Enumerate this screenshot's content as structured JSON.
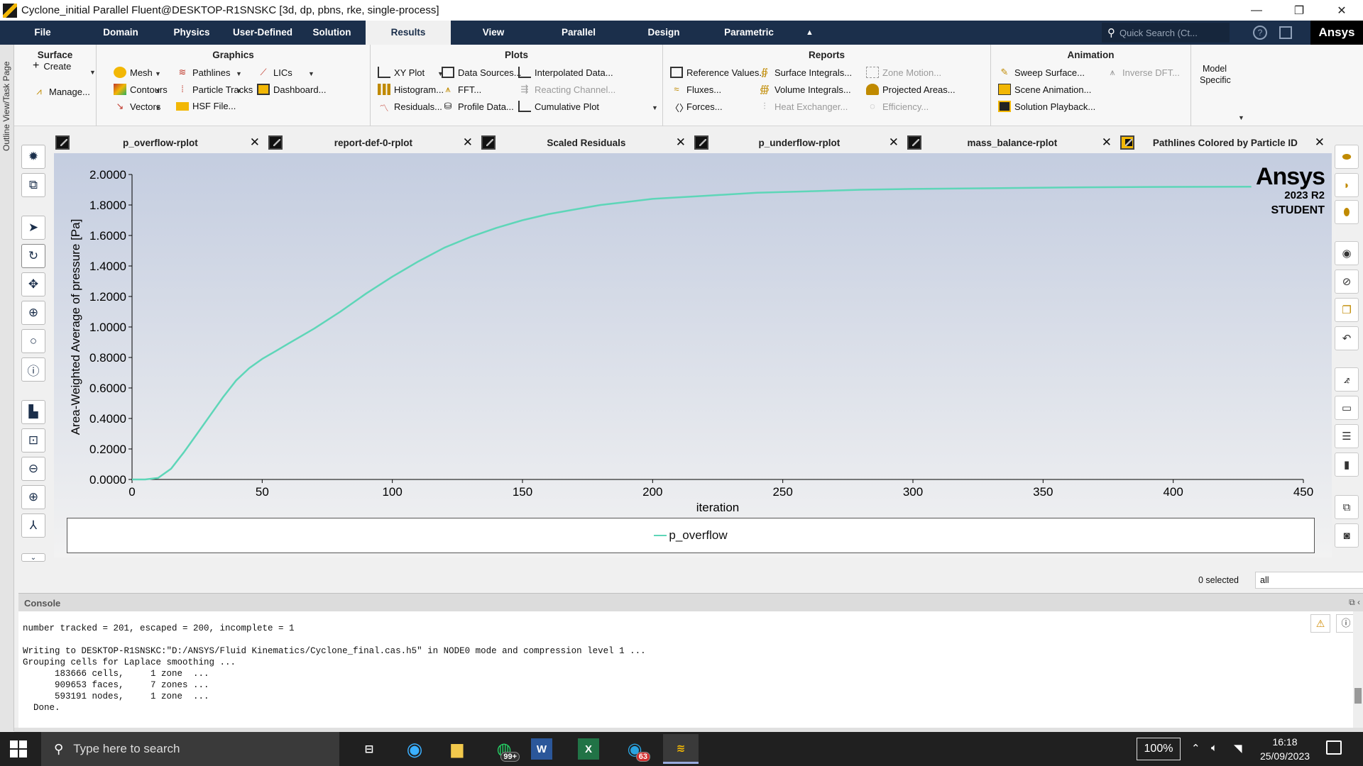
{
  "window": {
    "title": "Cyclone_initial Parallel Fluent@DESKTOP-R1SNSKC  [3d, dp, pbns, rke, single-process]",
    "min_glyph": "—",
    "restore_glyph": "❐",
    "close_glyph": "✕"
  },
  "menu": {
    "tabs": [
      "File",
      "Domain",
      "Physics",
      "User-Defined",
      "Solution",
      "Results",
      "View",
      "Parallel",
      "Design",
      "Parametric"
    ],
    "active": "Results",
    "quick_search_placeholder": "Quick Search (Ct...",
    "brand": "Ansys"
  },
  "ribbon": {
    "surface": {
      "title": "Surface",
      "create": "Create",
      "manage": "Manage..."
    },
    "graphics": {
      "title": "Graphics",
      "mesh": "Mesh",
      "contours": "Contours",
      "vectors": "Vectors",
      "pathlines": "Pathlines",
      "particle_tracks": "Particle Tracks",
      "hsf_file": "HSF File...",
      "lics": "LICs",
      "dashboard": "Dashboard..."
    },
    "plots": {
      "title": "Plots",
      "xy_plot": "XY Plot",
      "histogram": "Histogram...",
      "residuals": "Residuals...",
      "data_sources": "Data Sources...",
      "fft": "FFT...",
      "profile_data": "Profile Data...",
      "interpolated_data": "Interpolated Data...",
      "reacting_channel": "Reacting Channel...",
      "cumulative_plot": "Cumulative Plot"
    },
    "reports": {
      "title": "Reports",
      "reference_values": "Reference Values...",
      "fluxes": "Fluxes...",
      "forces": "Forces...",
      "surface_integrals": "Surface Integrals...",
      "volume_integrals": "Volume Integrals...",
      "heat_exchanger": "Heat Exchanger...",
      "zone_motion": "Zone Motion...",
      "projected_areas": "Projected Areas...",
      "efficiency": "Efficiency..."
    },
    "animation": {
      "title": "Animation",
      "sweep_surface": "Sweep Surface...",
      "scene_animation": "Scene Animation...",
      "solution_playback": "Solution Playback...",
      "inverse_dft": "Inverse DFT..."
    },
    "model_specific": {
      "line1": "Model",
      "line2": "Specific"
    }
  },
  "sidebar": {
    "outline_label": "Outline View/Task Page"
  },
  "doc_tabs": [
    "p_overflow-rplot",
    "report-def-0-rplot",
    "Scaled Residuals",
    "p_underflow-rplot",
    "mass_balance-rplot",
    "Pathlines Colored by Particle ID"
  ],
  "active_doc_tab": "p_overflow-rplot",
  "watermark": {
    "brand": "Ansys",
    "version": "2023 R2",
    "edition": "STUDENT"
  },
  "chart_data": {
    "type": "line",
    "xlabel": "iteration",
    "ylabel": "Area-Weighted Average of pressure [Pa]",
    "xlim": [
      0,
      450
    ],
    "ylim": [
      0,
      2.0
    ],
    "x_ticks": [
      "0",
      "50",
      "100",
      "150",
      "200",
      "250",
      "300",
      "350",
      "400",
      "450"
    ],
    "y_ticks": [
      "0.0000",
      "0.2000",
      "0.4000",
      "0.6000",
      "0.8000",
      "1.0000",
      "1.2000",
      "1.4000",
      "1.6000",
      "1.8000",
      "2.0000"
    ],
    "grid": false,
    "legend_position": "bottom",
    "series": [
      {
        "name": "p_overflow",
        "color": "#5ed6b8",
        "x": [
          0,
          5,
          10,
          15,
          20,
          25,
          30,
          35,
          40,
          45,
          50,
          55,
          60,
          65,
          70,
          80,
          90,
          100,
          110,
          120,
          130,
          140,
          150,
          160,
          170,
          180,
          190,
          200,
          220,
          240,
          260,
          280,
          300,
          330,
          360,
          390,
          430
        ],
        "y": [
          0.0,
          0.0,
          0.01,
          0.07,
          0.18,
          0.3,
          0.42,
          0.54,
          0.65,
          0.73,
          0.79,
          0.84,
          0.89,
          0.94,
          0.99,
          1.1,
          1.22,
          1.33,
          1.43,
          1.52,
          1.59,
          1.65,
          1.7,
          1.74,
          1.77,
          1.8,
          1.82,
          1.84,
          1.86,
          1.88,
          1.89,
          1.9,
          1.905,
          1.91,
          1.915,
          1.918,
          1.92
        ]
      }
    ]
  },
  "selection": {
    "count_label": "0 selected",
    "filter_value": "all"
  },
  "console": {
    "title": "Console",
    "text": "number tracked = 201, escaped = 200, incomplete = 1\n\nWriting to DESKTOP-R1SNSKC:\"D:/ANSYS/Fluid Kinematics/Cyclone_final.cas.h5\" in NODE0 mode and compression level 1 ...\nGrouping cells for Laplace smoothing ...\n      183666 cells,     1 zone  ...\n      909653 faces,     7 zones ...\n      593191 nodes,     1 zone  ...\n  Done."
  },
  "taskbar": {
    "search_placeholder": "Type here to search",
    "whatsapp_badge": "99+",
    "telegram_badge": "63",
    "zoom": "100%",
    "time": "16:18",
    "date": "25/09/2023"
  }
}
